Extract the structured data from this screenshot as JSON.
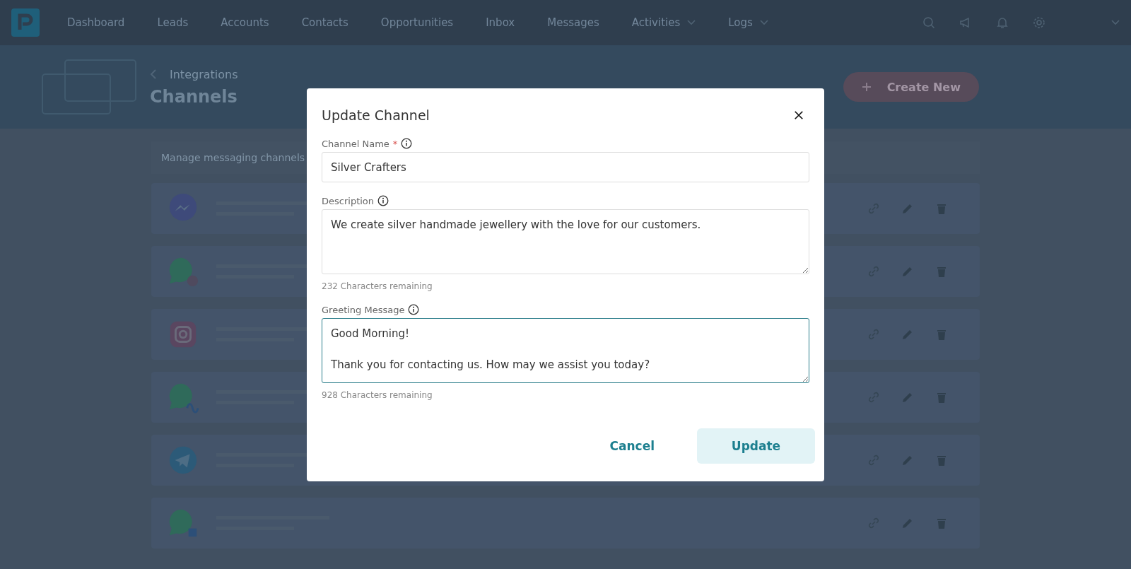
{
  "nav": {
    "items": [
      {
        "label": "Dashboard",
        "has_menu": false
      },
      {
        "label": "Leads",
        "has_menu": false
      },
      {
        "label": "Accounts",
        "has_menu": false
      },
      {
        "label": "Contacts",
        "has_menu": false
      },
      {
        "label": "Opportunities",
        "has_menu": false
      },
      {
        "label": "Inbox",
        "has_menu": false
      },
      {
        "label": "Messages",
        "has_menu": false
      },
      {
        "label": "Activities",
        "has_menu": true
      },
      {
        "label": "Logs",
        "has_menu": true
      }
    ]
  },
  "header": {
    "breadcrumb": "Integrations",
    "title": "Channels",
    "create_button": "Create New"
  },
  "intro": "Manage messaging channels",
  "channels": [
    {
      "kind": "messenger"
    },
    {
      "kind": "whatsapp-instagram"
    },
    {
      "kind": "instagram"
    },
    {
      "kind": "whatsapp-meta"
    },
    {
      "kind": "telegram"
    },
    {
      "kind": "whatsapp-qr"
    }
  ],
  "dialog": {
    "title": "Update Channel",
    "fields": [
      {
        "label": "Channel Name",
        "required_mark": "*",
        "kind": "input",
        "value": "Silver Crafters",
        "focused": false
      },
      {
        "label": "Description",
        "kind": "textarea",
        "value": "We create silver handmade jewellery with the love for our customers.",
        "counter": "232 Characters remaining",
        "focused": false
      },
      {
        "label": "Greeting Message",
        "kind": "textarea",
        "value": "Good Morning!\n\nThank you for contacting us. How may we assist you today?",
        "counter": "928 Characters remaining",
        "focused": true
      }
    ],
    "buttons": [
      {
        "label": "Cancel",
        "kind": "text"
      },
      {
        "label": "Update",
        "kind": "primary"
      }
    ]
  }
}
